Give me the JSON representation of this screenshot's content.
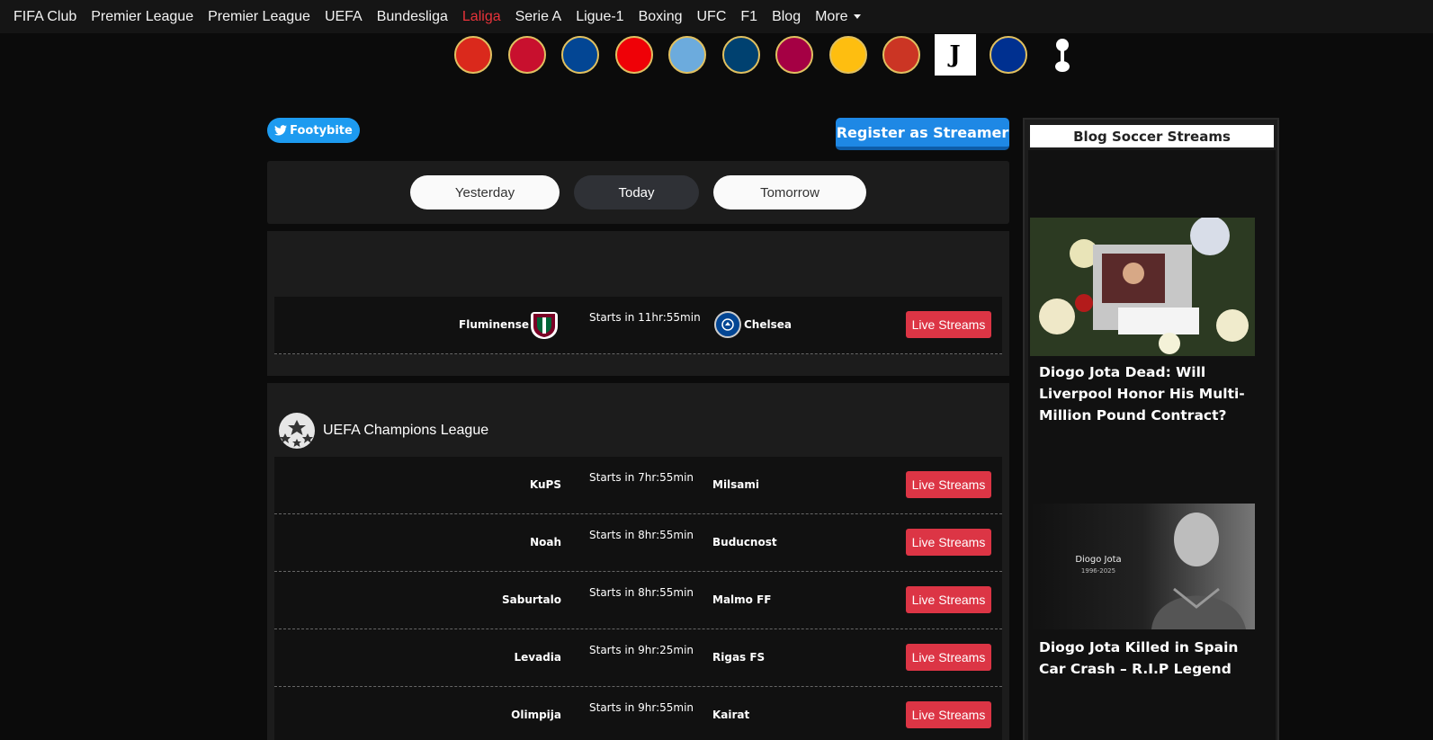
{
  "nav": {
    "items": [
      "FIFA Club",
      "Premier League",
      "Premier League",
      "UEFA",
      "Bundesliga",
      "Laliga",
      "Serie A",
      "Ligue-1",
      "Boxing",
      "UFC",
      "F1",
      "Blog",
      "More"
    ],
    "active_index": 5
  },
  "club_logos": [
    {
      "name": "Manchester United",
      "color": "#da291c"
    },
    {
      "name": "Liverpool",
      "color": "#c8102e"
    },
    {
      "name": "Chelsea",
      "color": "#034694"
    },
    {
      "name": "Arsenal",
      "color": "#ef0107"
    },
    {
      "name": "Manchester City",
      "color": "#6cabdd"
    },
    {
      "name": "Paris Saint-Germain",
      "color": "#004170"
    },
    {
      "name": "Barcelona",
      "color": "#a50044"
    },
    {
      "name": "Real Madrid",
      "color": "#febe10"
    },
    {
      "name": "Atletico Madrid",
      "color": "#cb3524"
    },
    {
      "name": "Juventus",
      "color": "#000000"
    },
    {
      "name": "Leicester City",
      "color": "#003090"
    },
    {
      "name": "Tottenham",
      "color": "#132257"
    }
  ],
  "twitter_label": "Footybite",
  "register_label": "Register as Streamer",
  "day_tabs": {
    "yesterday": "Yesterday",
    "today": "Today",
    "tomorrow": "Tomorrow"
  },
  "featured_match": {
    "home": "Fluminense",
    "time": "Starts in 11hr:55min",
    "away": "Chelsea",
    "button": "Live Streams"
  },
  "league": {
    "name": "UEFA Champions League"
  },
  "matches": [
    {
      "home": "KuPS",
      "time": "Starts in 7hr:55min",
      "away": "Milsami",
      "button": "Live Streams"
    },
    {
      "home": "Noah",
      "time": "Starts in 8hr:55min",
      "away": "Buducnost",
      "button": "Live Streams"
    },
    {
      "home": "Saburtalo",
      "time": "Starts in 8hr:55min",
      "away": "Malmo FF",
      "button": "Live Streams"
    },
    {
      "home": "Levadia",
      "time": "Starts in 9hr:25min",
      "away": "Rigas FS",
      "button": "Live Streams"
    },
    {
      "home": "Olimpija",
      "time": "Starts in 9hr:55min",
      "away": "Kairat",
      "button": "Live Streams"
    }
  ],
  "sidebar": {
    "title": "Blog Soccer Streams",
    "posts": [
      {
        "title": "Diogo Jota Dead: Will Liverpool Honor His Multi-Million Pound Contract?"
      },
      {
        "title": "Diogo Jota Killed in Spain Car Crash – R.I.P Legend",
        "image_caption": "Diogo Jota",
        "image_years": "1996-2025"
      }
    ]
  },
  "colors": {
    "accent_red": "#dc3545",
    "twitter_blue": "#1d9bf0",
    "register_blue": "#1e88e5",
    "active_nav": "#e8333a"
  }
}
